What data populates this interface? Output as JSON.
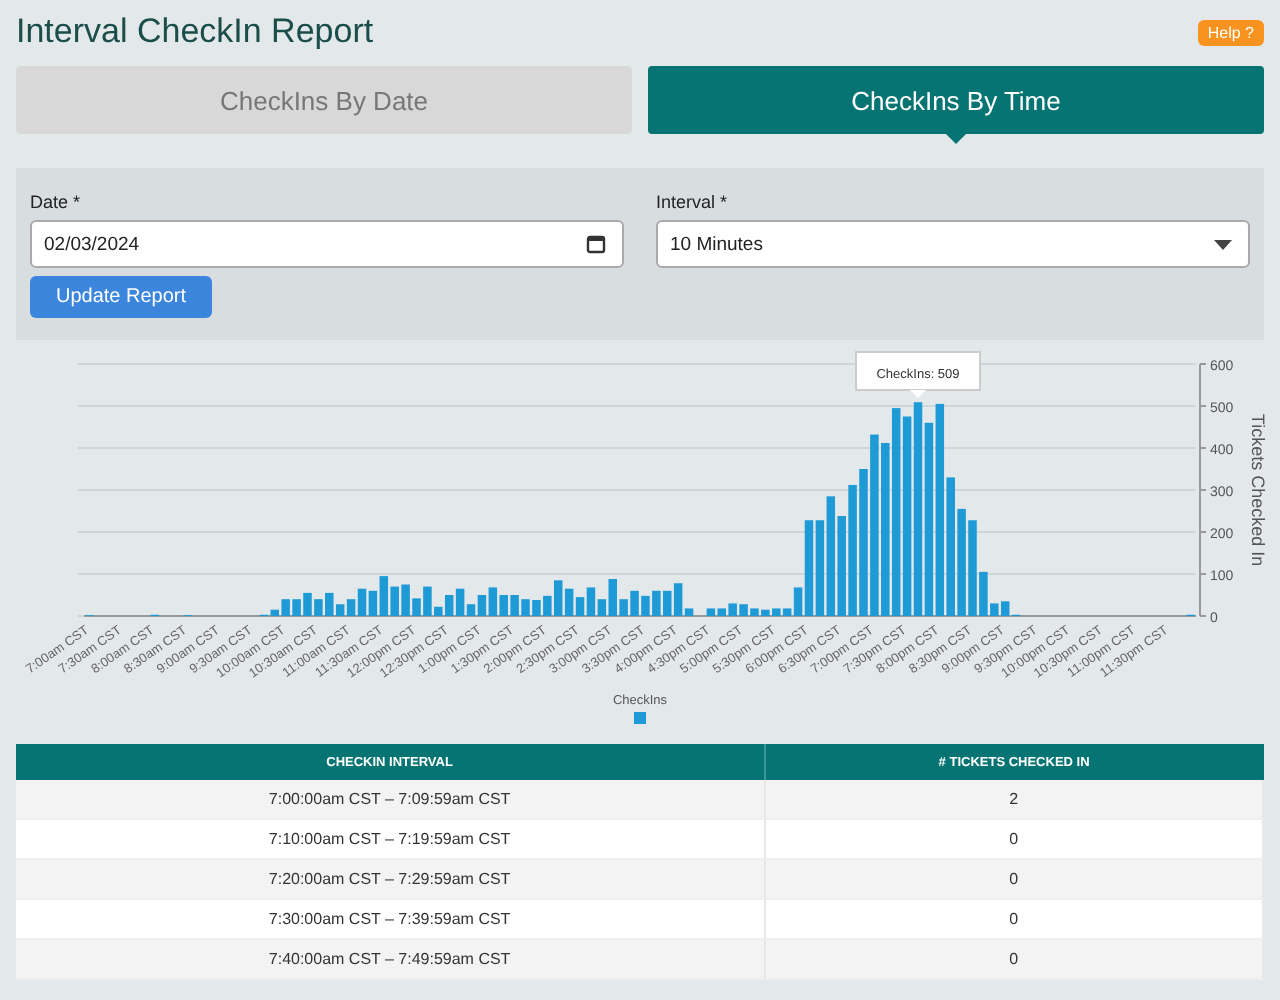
{
  "page": {
    "title": "Interval CheckIn Report",
    "help_button": "Help ?"
  },
  "tabs": [
    {
      "label": "CheckIns By Date",
      "selected": false
    },
    {
      "label": "CheckIns By Time",
      "selected": true
    }
  ],
  "form": {
    "date": {
      "label": "Date *",
      "value": "02/03/2024"
    },
    "interval": {
      "label": "Interval *",
      "value": "10 Minutes"
    },
    "button": "Update Report"
  },
  "chart": {
    "chart_data": {
      "type": "bar",
      "ylabel": "Tickets Checked In",
      "ylim": [
        0,
        600
      ],
      "yticks": [
        0,
        100,
        200,
        300,
        400,
        500,
        600
      ],
      "series": [
        {
          "name": "CheckIns",
          "color": "#1e9ad6",
          "values": [
            2,
            0,
            0,
            0,
            0,
            0,
            3,
            0,
            0,
            2,
            0,
            0,
            0,
            0,
            0,
            0,
            3,
            15,
            40,
            40,
            55,
            40,
            55,
            28,
            40,
            65,
            60,
            95,
            70,
            75,
            42,
            70,
            22,
            50,
            65,
            28,
            50,
            68,
            50,
            50,
            40,
            38,
            48,
            85,
            65,
            45,
            68,
            40,
            88,
            40,
            60,
            48,
            60,
            60,
            78,
            18,
            0,
            18,
            18,
            30,
            28,
            18,
            15,
            18,
            18,
            68,
            228,
            228,
            285,
            238,
            312,
            350,
            432,
            412,
            495,
            475,
            509,
            460,
            505,
            330,
            255,
            228,
            105,
            30,
            35,
            3,
            0,
            0,
            0,
            0,
            0,
            0,
            0,
            0,
            0,
            0,
            0,
            0,
            0,
            0,
            0,
            3
          ]
        }
      ],
      "grid": true,
      "categories": [
        "7:00am CST",
        null,
        null,
        "7:30am CST",
        null,
        null,
        "8:00am CST",
        null,
        null,
        "8:30am CST",
        null,
        null,
        "9:00am CST",
        null,
        null,
        "9:30am CST",
        null,
        null,
        "10:00am CST",
        null,
        null,
        "10:30am CST",
        null,
        null,
        "11:00am CST",
        null,
        null,
        "11:30am CST",
        null,
        null,
        "12:00pm CST",
        null,
        null,
        "12:30pm CST",
        null,
        null,
        "1:00pm CST",
        null,
        null,
        "1:30pm CST",
        null,
        null,
        "2:00pm CST",
        null,
        null,
        "2:30pm CST",
        null,
        null,
        "3:00pm CST",
        null,
        null,
        "3:30pm CST",
        null,
        null,
        "4:00pm CST",
        null,
        null,
        "4:30pm CST",
        null,
        null,
        "5:00pm CST",
        null,
        null,
        "5:30pm CST",
        null,
        null,
        "6:00pm CST",
        null,
        null,
        "6:30pm CST",
        null,
        null,
        "7:00pm CST",
        null,
        null,
        "7:30pm CST",
        null,
        null,
        "8:00pm CST",
        null,
        null,
        "8:30pm CST",
        null,
        null,
        "9:00pm CST",
        null,
        null,
        "9:30pm CST",
        null,
        null,
        "10:00pm CST",
        null,
        null,
        "10:30pm CST",
        null,
        null,
        "11:00pm CST",
        null,
        null,
        "11:30pm CST",
        null,
        null
      ],
      "annotations": [
        "CheckIns: 509"
      ]
    }
  },
  "table": {
    "columns": [
      "CHECKIN INTERVAL",
      "# TICKETS CHECKED IN"
    ],
    "rows": [
      [
        "7:00:00am CST – 7:09:59am CST",
        "2"
      ],
      [
        "7:10:00am CST – 7:19:59am CST",
        "0"
      ],
      [
        "7:20:00am CST – 7:29:59am CST",
        "0"
      ],
      [
        "7:30:00am CST – 7:39:59am CST",
        "0"
      ],
      [
        "7:40:00am CST – 7:49:59am CST",
        "0"
      ]
    ]
  }
}
